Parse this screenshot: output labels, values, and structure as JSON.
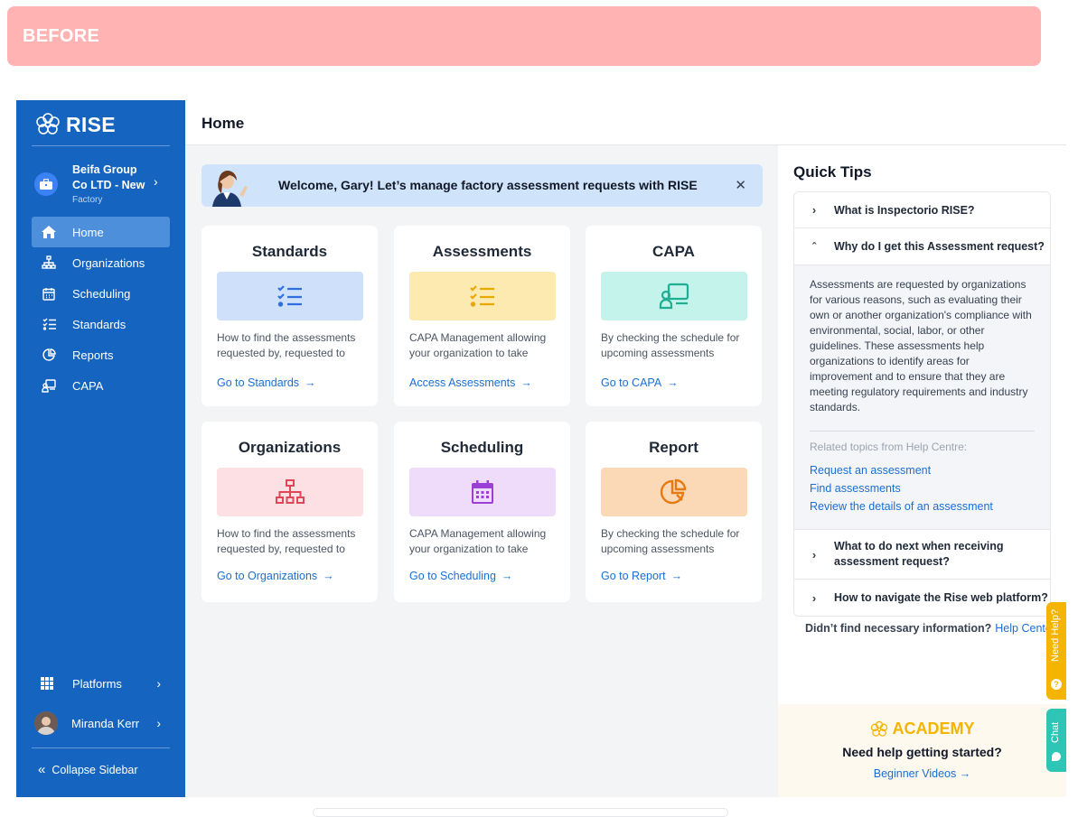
{
  "banner": {
    "label": "BEFORE"
  },
  "sidebar": {
    "brand": "RISE",
    "org": {
      "name": "Beifa Group Co LTD - New",
      "type": "Factory"
    },
    "nav": [
      {
        "label": "Home",
        "icon": "home-icon",
        "active": true
      },
      {
        "label": "Organizations",
        "icon": "organizations-icon"
      },
      {
        "label": "Scheduling",
        "icon": "calendar-icon"
      },
      {
        "label": "Standards",
        "icon": "checklist-icon"
      },
      {
        "label": "Reports",
        "icon": "reports-icon"
      },
      {
        "label": "CAPA",
        "icon": "capa-icon"
      }
    ],
    "platforms": "Platforms",
    "user": "Miranda Kerr",
    "collapse": "Collapse Sidebar"
  },
  "header": {
    "title": "Home"
  },
  "welcome": {
    "message": "Welcome, Gary! Let’s manage factory assessment requests with RISE"
  },
  "cards": [
    {
      "title": "Standards",
      "desc": "How to find the assessments requested by, requested to",
      "link": "Go to Standards",
      "bg": "#cfe0fb",
      "fg": "#2f6fde"
    },
    {
      "title": "Assessments",
      "desc": "CAPA Management allowing your organization to take",
      "link": "Access Assessments",
      "bg": "#fdeab0",
      "fg": "#e8a800"
    },
    {
      "title": "CAPA",
      "desc": "By checking the schedule for upcoming assessments",
      "link": "Go to CAPA",
      "bg": "#c3f3ea",
      "fg": "#1fae94"
    },
    {
      "title": "Organizations",
      "desc": "How to find the assessments requested by, requested to",
      "link": "Go to Organizations",
      "bg": "#fde0e4",
      "fg": "#e0455a"
    },
    {
      "title": "Scheduling",
      "desc": "CAPA Management allowing your organization to take",
      "link": "Go to Scheduling",
      "bg": "#efdcfb",
      "fg": "#9b3fd6"
    },
    {
      "title": "Report",
      "desc": "By checking the schedule for upcoming assessments",
      "link": "Go to Report",
      "bg": "#fcd9b6",
      "fg": "#e67a12"
    }
  ],
  "tips": {
    "title": "Quick Tips",
    "items": [
      {
        "q": "What is Inspectorio RISE?"
      },
      {
        "q": "Why do I get this Assessment request?"
      },
      {
        "q": "What to do next when receiving assessment request?"
      },
      {
        "q": "How to navigate the Rise web platform?"
      }
    ],
    "answer": "Assessments are requested by organizations for various reasons, such as evaluating their own or another organization's compliance with environmental, social, labor, or other guidelines. These assessments help organizations to identify areas for improvement and to ensure that they are meeting regulatory requirements and industry standards.",
    "related_label": "Related topics from Help Centre:",
    "related": [
      "Request an assessment",
      "Find assessments",
      "Review the details of an assessment"
    ],
    "not_found": "Didn’t find necessary information?",
    "help_center": "Help Center"
  },
  "academy": {
    "brand": "ACADEMY",
    "heading": "Need help getting started?",
    "link": "Beginner Videos"
  },
  "side_tabs": {
    "help": "Need Help?",
    "chat": "Chat"
  }
}
